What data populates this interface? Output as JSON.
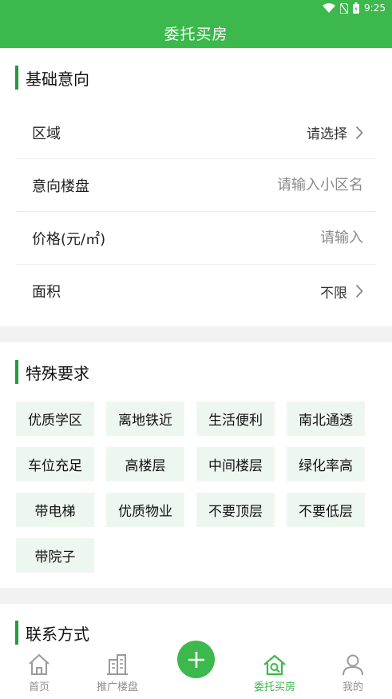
{
  "status_bar": {
    "time": "9:25"
  },
  "header": {
    "title": "委托买房"
  },
  "basic": {
    "title": "基础意向",
    "area": {
      "label": "区域",
      "value": "请选择"
    },
    "estate": {
      "label": "意向楼盘",
      "placeholder": "请输入小区名"
    },
    "price": {
      "label": "价格(元/㎡)",
      "placeholder": "请输入"
    },
    "size": {
      "label": "面积",
      "value": "不限"
    }
  },
  "special": {
    "title": "特殊要求",
    "tags": [
      "优质学区",
      "离地铁近",
      "生活便利",
      "南北通透",
      "车位充足",
      "高楼层",
      "中间楼层",
      "绿化率高",
      "带电梯",
      "优质物业",
      "不要顶层",
      "不要低层",
      "带院子"
    ]
  },
  "contact": {
    "title": "联系方式"
  },
  "tabbar": {
    "home": "首页",
    "promote": "推广楼盘",
    "entrust": "委托买房",
    "mine": "我的"
  },
  "colors": {
    "brand": "#3cb84c",
    "accent_bar": "#239b3d",
    "tag_bg": "#eef7ef"
  }
}
